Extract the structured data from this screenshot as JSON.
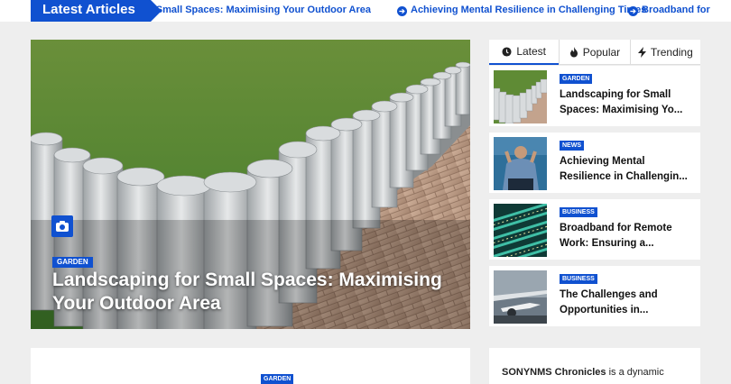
{
  "ticker": {
    "label": "Latest Articles",
    "items": [
      "Landscaping for Small Spaces: Maximising Your Outdoor Area",
      "Achieving Mental Resilience in Challenging Times",
      "Broadband for"
    ]
  },
  "hero": {
    "category": "GARDEN",
    "title": "Landscaping for Small Spaces: Maximising Your Outdoor Area",
    "icon": "camera-icon"
  },
  "tabs": [
    {
      "label": "Latest",
      "icon": "clock-icon"
    },
    {
      "label": "Popular",
      "icon": "fire-icon"
    },
    {
      "label": "Trending",
      "icon": "bolt-icon"
    }
  ],
  "posts": [
    {
      "category": "GARDEN",
      "title": "Landscaping for Small Spaces: Maximising Yo..."
    },
    {
      "category": "NEWS",
      "title": "Achieving Mental Resilience in Challengin..."
    },
    {
      "category": "BUSINESS",
      "title": "Broadband for Remote Work: Ensuring a..."
    },
    {
      "category": "BUSINESS",
      "title": "The Challenges and Opportunities in..."
    }
  ],
  "bottom": {
    "category": "GARDEN",
    "about_brand": "SONYNMS Chronicles",
    "about_text": " is a dynamic"
  },
  "colors": {
    "accent": "#1051d0",
    "background": "#eeeeee"
  }
}
